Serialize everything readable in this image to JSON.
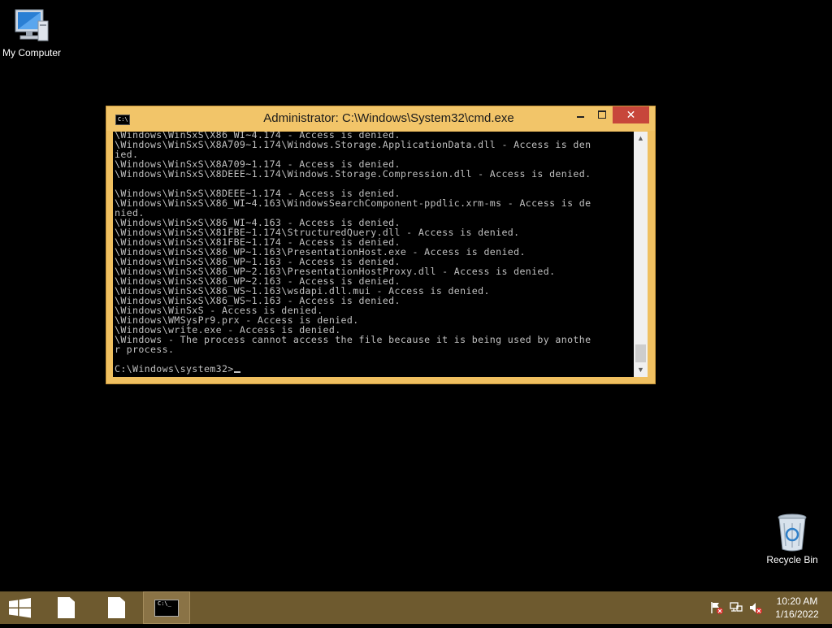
{
  "desktop": {
    "icons": [
      {
        "label": "My Computer",
        "icon": "computer-icon"
      },
      {
        "label": "Recycle Bin",
        "icon": "recycle-bin-icon"
      }
    ]
  },
  "window": {
    "title": "Administrator: C:\\Windows\\System32\\cmd.exe",
    "icon_text": "C:\\",
    "buttons": {
      "minimize": "minimize",
      "maximize": "maximize",
      "close": "✕"
    },
    "console_lines": [
      "\\Windows\\WinSxS\\X86_WI~4.174 - Access is denied.",
      "\\Windows\\WinSxS\\X8A709~1.174\\Windows.Storage.ApplicationData.dll - Access is den",
      "ied.",
      "\\Windows\\WinSxS\\X8A709~1.174 - Access is denied.",
      "\\Windows\\WinSxS\\X8DEEE~1.174\\Windows.Storage.Compression.dll - Access is denied.",
      "",
      "\\Windows\\WinSxS\\X8DEEE~1.174 - Access is denied.",
      "\\Windows\\WinSxS\\X86_WI~4.163\\WindowsSearchComponent-ppdlic.xrm-ms - Access is de",
      "nied.",
      "\\Windows\\WinSxS\\X86_WI~4.163 - Access is denied.",
      "\\Windows\\WinSxS\\X81FBE~1.174\\StructuredQuery.dll - Access is denied.",
      "\\Windows\\WinSxS\\X81FBE~1.174 - Access is denied.",
      "\\Windows\\WinSxS\\X86_WP~1.163\\PresentationHost.exe - Access is denied.",
      "\\Windows\\WinSxS\\X86_WP~1.163 - Access is denied.",
      "\\Windows\\WinSxS\\X86_WP~2.163\\PresentationHostProxy.dll - Access is denied.",
      "\\Windows\\WinSxS\\X86_WP~2.163 - Access is denied.",
      "\\Windows\\WinSxS\\X86_WS~1.163\\wsdapi.dll.mui - Access is denied.",
      "\\Windows\\WinSxS\\X86_WS~1.163 - Access is denied.",
      "\\Windows\\WinSxS - Access is denied.",
      "\\Windows\\WMSysPr9.prx - Access is denied.",
      "\\Windows\\write.exe - Access is denied.",
      "\\Windows - The process cannot access the file because it is being used by anothe",
      "r process.",
      ""
    ],
    "prompt": "C:\\Windows\\system32>",
    "scrollbar": {
      "position": 0.97
    }
  },
  "taskbar": {
    "start": "start-icon",
    "items": [
      {
        "icon": "document-icon",
        "active": false
      },
      {
        "icon": "document-icon",
        "active": false
      },
      {
        "icon": "cmd-icon",
        "active": true,
        "icon_text": "C:\\_"
      }
    ],
    "tray": [
      "flag-icon",
      "network-icon",
      "volume-muted-icon"
    ],
    "clock": {
      "time": "10:20 AM",
      "date": "1/16/2022"
    }
  },
  "colors": {
    "window_frame": "#f0c060",
    "close_button": "#c7463b",
    "taskbar": "#6e5a2f",
    "console_text": "#c0c0c0"
  }
}
